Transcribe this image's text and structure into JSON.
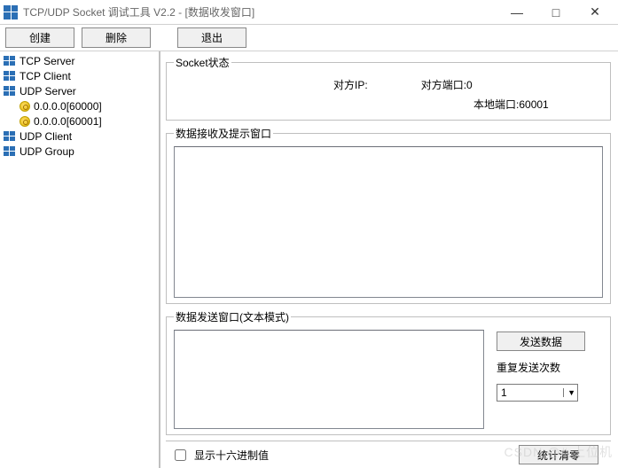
{
  "titlebar": {
    "title": "TCP/UDP Socket 调试工具 V2.2 - [数据收发窗口]"
  },
  "toolbar": {
    "create_label": "创建",
    "delete_label": "删除",
    "exit_label": "退出"
  },
  "sidebar": {
    "items": [
      {
        "label": "TCP Server",
        "icon": "server"
      },
      {
        "label": "TCP Client",
        "icon": "server"
      },
      {
        "label": "UDP Server",
        "icon": "server",
        "children": [
          {
            "label": "0.0.0.0[60000]",
            "icon": "gold"
          },
          {
            "label": "0.0.0.0[60001]",
            "icon": "gold"
          }
        ]
      },
      {
        "label": "UDP Client",
        "icon": "server"
      },
      {
        "label": "UDP Group",
        "icon": "server"
      }
    ]
  },
  "status": {
    "legend": "Socket状态",
    "peer_ip_label": "对方IP:",
    "peer_ip_value": "",
    "peer_port_label": "对方端口:",
    "peer_port_value": "0",
    "local_port_label": "本地端口:",
    "local_port_value": "60001"
  },
  "recv": {
    "legend": "数据接收及提示窗口",
    "text": ""
  },
  "send": {
    "legend": "数据发送窗口(文本模式)",
    "text": "",
    "send_button": "发送数据",
    "repeat_label": "重复发送次数",
    "repeat_value": "1"
  },
  "bottom": {
    "hex_label": "显示十六进制值",
    "hex_checked": false,
    "reset_label": "统计清零"
  },
  "watermark": "CSDN @# 上位机"
}
